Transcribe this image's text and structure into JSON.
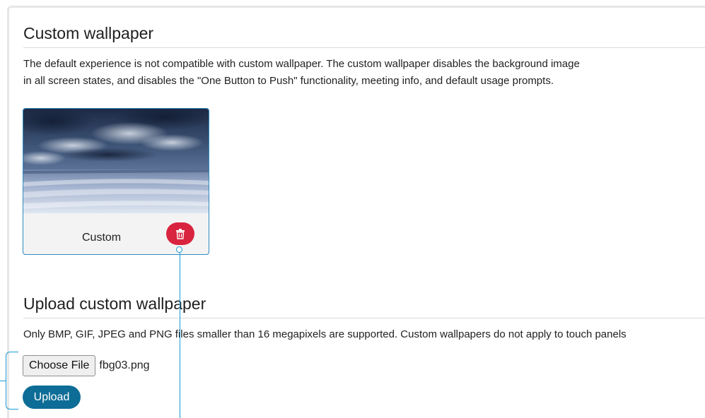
{
  "custom_wallpaper": {
    "title": "Custom wallpaper",
    "description_line1": "The default experience is not compatible with custom wallpaper. The custom wallpaper disables the background image",
    "description_line2": "in all screen states, and disables the \"One Button to Push\" functionality, meeting info, and default usage prompts.",
    "card": {
      "label": "Custom",
      "thumbnail": "stormy-sky-beach-wallpaper",
      "delete_icon": "trash-icon",
      "delete_color": "#d9243f"
    }
  },
  "upload": {
    "title": "Upload custom wallpaper",
    "description": "Only BMP, GIF, JPEG and PNG files smaller than 16 megapixels are supported. Custom wallpapers do not apply to touch panels",
    "choose_file_label": "Choose File",
    "file_name": "fbg03.png",
    "upload_label": "Upload",
    "upload_color": "#0d6d96"
  },
  "accent_color": "#1a9ad6"
}
